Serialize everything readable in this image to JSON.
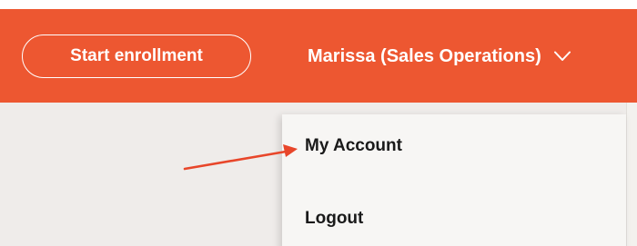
{
  "header": {
    "start_enrollment_label": "Start enrollment",
    "user_menu_label": "Marissa (Sales Operations)",
    "chevron_icon": "chevron-down-icon",
    "background_color": "#ed5731"
  },
  "dropdown": {
    "items": [
      {
        "label": "My Account"
      },
      {
        "label": "Logout"
      }
    ]
  },
  "annotation": {
    "arrow_icon": "pointer-arrow-icon",
    "color": "#e8462a"
  }
}
